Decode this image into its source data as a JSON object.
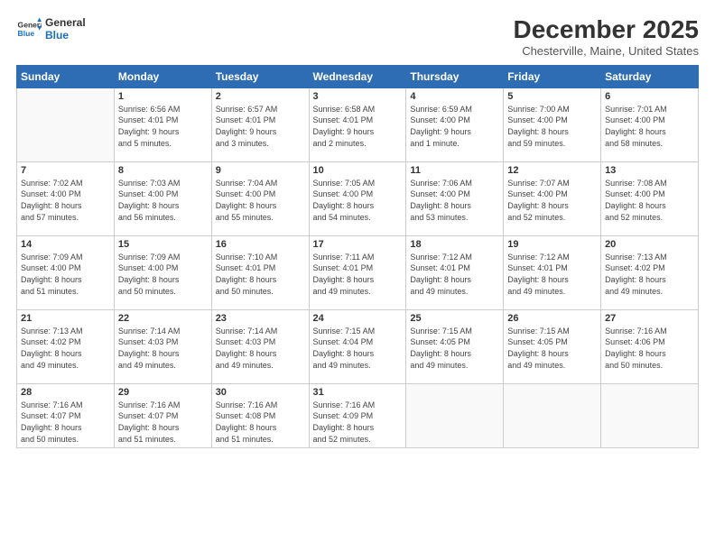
{
  "logo": {
    "line1": "General",
    "line2": "Blue"
  },
  "title": "December 2025",
  "location": "Chesterville, Maine, United States",
  "days_of_week": [
    "Sunday",
    "Monday",
    "Tuesday",
    "Wednesday",
    "Thursday",
    "Friday",
    "Saturday"
  ],
  "weeks": [
    [
      {
        "day": "",
        "info": ""
      },
      {
        "day": "1",
        "info": "Sunrise: 6:56 AM\nSunset: 4:01 PM\nDaylight: 9 hours\nand 5 minutes."
      },
      {
        "day": "2",
        "info": "Sunrise: 6:57 AM\nSunset: 4:01 PM\nDaylight: 9 hours\nand 3 minutes."
      },
      {
        "day": "3",
        "info": "Sunrise: 6:58 AM\nSunset: 4:01 PM\nDaylight: 9 hours\nand 2 minutes."
      },
      {
        "day": "4",
        "info": "Sunrise: 6:59 AM\nSunset: 4:00 PM\nDaylight: 9 hours\nand 1 minute."
      },
      {
        "day": "5",
        "info": "Sunrise: 7:00 AM\nSunset: 4:00 PM\nDaylight: 8 hours\nand 59 minutes."
      },
      {
        "day": "6",
        "info": "Sunrise: 7:01 AM\nSunset: 4:00 PM\nDaylight: 8 hours\nand 58 minutes."
      }
    ],
    [
      {
        "day": "7",
        "info": "Sunrise: 7:02 AM\nSunset: 4:00 PM\nDaylight: 8 hours\nand 57 minutes."
      },
      {
        "day": "8",
        "info": "Sunrise: 7:03 AM\nSunset: 4:00 PM\nDaylight: 8 hours\nand 56 minutes."
      },
      {
        "day": "9",
        "info": "Sunrise: 7:04 AM\nSunset: 4:00 PM\nDaylight: 8 hours\nand 55 minutes."
      },
      {
        "day": "10",
        "info": "Sunrise: 7:05 AM\nSunset: 4:00 PM\nDaylight: 8 hours\nand 54 minutes."
      },
      {
        "day": "11",
        "info": "Sunrise: 7:06 AM\nSunset: 4:00 PM\nDaylight: 8 hours\nand 53 minutes."
      },
      {
        "day": "12",
        "info": "Sunrise: 7:07 AM\nSunset: 4:00 PM\nDaylight: 8 hours\nand 52 minutes."
      },
      {
        "day": "13",
        "info": "Sunrise: 7:08 AM\nSunset: 4:00 PM\nDaylight: 8 hours\nand 52 minutes."
      }
    ],
    [
      {
        "day": "14",
        "info": "Sunrise: 7:09 AM\nSunset: 4:00 PM\nDaylight: 8 hours\nand 51 minutes."
      },
      {
        "day": "15",
        "info": "Sunrise: 7:09 AM\nSunset: 4:00 PM\nDaylight: 8 hours\nand 50 minutes."
      },
      {
        "day": "16",
        "info": "Sunrise: 7:10 AM\nSunset: 4:01 PM\nDaylight: 8 hours\nand 50 minutes."
      },
      {
        "day": "17",
        "info": "Sunrise: 7:11 AM\nSunset: 4:01 PM\nDaylight: 8 hours\nand 49 minutes."
      },
      {
        "day": "18",
        "info": "Sunrise: 7:12 AM\nSunset: 4:01 PM\nDaylight: 8 hours\nand 49 minutes."
      },
      {
        "day": "19",
        "info": "Sunrise: 7:12 AM\nSunset: 4:01 PM\nDaylight: 8 hours\nand 49 minutes."
      },
      {
        "day": "20",
        "info": "Sunrise: 7:13 AM\nSunset: 4:02 PM\nDaylight: 8 hours\nand 49 minutes."
      }
    ],
    [
      {
        "day": "21",
        "info": "Sunrise: 7:13 AM\nSunset: 4:02 PM\nDaylight: 8 hours\nand 49 minutes."
      },
      {
        "day": "22",
        "info": "Sunrise: 7:14 AM\nSunset: 4:03 PM\nDaylight: 8 hours\nand 49 minutes."
      },
      {
        "day": "23",
        "info": "Sunrise: 7:14 AM\nSunset: 4:03 PM\nDaylight: 8 hours\nand 49 minutes."
      },
      {
        "day": "24",
        "info": "Sunrise: 7:15 AM\nSunset: 4:04 PM\nDaylight: 8 hours\nand 49 minutes."
      },
      {
        "day": "25",
        "info": "Sunrise: 7:15 AM\nSunset: 4:05 PM\nDaylight: 8 hours\nand 49 minutes."
      },
      {
        "day": "26",
        "info": "Sunrise: 7:15 AM\nSunset: 4:05 PM\nDaylight: 8 hours\nand 49 minutes."
      },
      {
        "day": "27",
        "info": "Sunrise: 7:16 AM\nSunset: 4:06 PM\nDaylight: 8 hours\nand 50 minutes."
      }
    ],
    [
      {
        "day": "28",
        "info": "Sunrise: 7:16 AM\nSunset: 4:07 PM\nDaylight: 8 hours\nand 50 minutes."
      },
      {
        "day": "29",
        "info": "Sunrise: 7:16 AM\nSunset: 4:07 PM\nDaylight: 8 hours\nand 51 minutes."
      },
      {
        "day": "30",
        "info": "Sunrise: 7:16 AM\nSunset: 4:08 PM\nDaylight: 8 hours\nand 51 minutes."
      },
      {
        "day": "31",
        "info": "Sunrise: 7:16 AM\nSunset: 4:09 PM\nDaylight: 8 hours\nand 52 minutes."
      },
      {
        "day": "",
        "info": ""
      },
      {
        "day": "",
        "info": ""
      },
      {
        "day": "",
        "info": ""
      }
    ]
  ]
}
